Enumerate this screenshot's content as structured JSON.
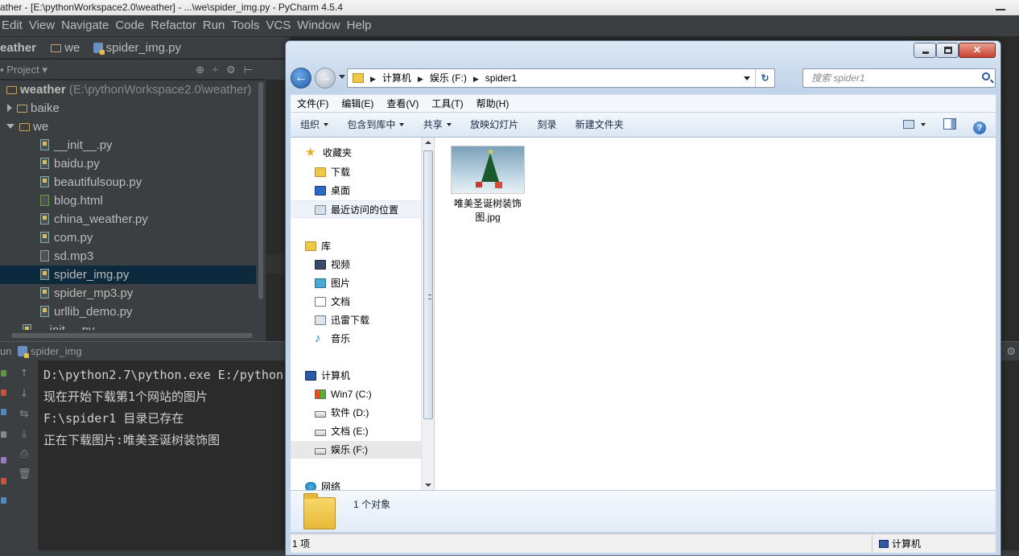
{
  "pycharm": {
    "title": "ather - [E:\\pythonWorkspace2.0\\weather] - ...\\we\\spider_img.py - PyCharm 4.5.4",
    "menu": [
      "Edit",
      "View",
      "Navigate",
      "Code",
      "Refactor",
      "Run",
      "Tools",
      "VCS",
      "Window",
      "Help"
    ],
    "breadcrumb": {
      "root": "eather",
      "folder": "we",
      "file": "spider_img.py"
    },
    "project_panel": {
      "title": "Project",
      "root_label": "weather",
      "root_path": "(E:\\pythonWorkspace2.0\\weather)",
      "items": [
        {
          "label": "baike",
          "kind": "folder"
        },
        {
          "label": "we",
          "kind": "folder-open"
        },
        {
          "label": "__init__.py",
          "kind": "py"
        },
        {
          "label": "baidu.py",
          "kind": "py"
        },
        {
          "label": "beautifulsoup.py",
          "kind": "py"
        },
        {
          "label": "blog.html",
          "kind": "html"
        },
        {
          "label": "china_weather.py",
          "kind": "py"
        },
        {
          "label": "com.py",
          "kind": "py"
        },
        {
          "label": "sd.mp3",
          "kind": "mp3"
        },
        {
          "label": "spider_img.py",
          "kind": "py",
          "selected": true
        },
        {
          "label": "spider_mp3.py",
          "kind": "py"
        },
        {
          "label": "urllib_demo.py",
          "kind": "py"
        },
        {
          "label": "__init__.py",
          "kind": "py"
        }
      ]
    },
    "run_panel": {
      "title": "un",
      "config": "spider_img",
      "console_lines": [
        "D:\\python2.7\\python.exe E:/python",
        "现在开始下载第1个网站的图片",
        "F:\\spider1 目录已存在",
        "正在下载图片:唯美圣诞树装饰图"
      ]
    }
  },
  "explorer": {
    "address": {
      "segments": [
        "计算机",
        "娱乐 (F:)",
        "spider1"
      ]
    },
    "search_placeholder": "搜索 spider1",
    "menu": [
      "文件(F)",
      "编辑(E)",
      "查看(V)",
      "工具(T)",
      "帮助(H)"
    ],
    "commands": [
      "组织",
      "包含到库中",
      "共享",
      "放映幻灯片",
      "刻录",
      "新建文件夹"
    ],
    "nav": {
      "favorites_header": "收藏夹",
      "favorites": [
        "下载",
        "桌面",
        "最近访问的位置"
      ],
      "libraries_header": "库",
      "libraries": [
        "视频",
        "图片",
        "文档",
        "迅雷下载",
        "音乐"
      ],
      "computer_header": "计算机",
      "drives": [
        "Win7 (C:)",
        "软件 (D:)",
        "文档 (E:)",
        "娱乐 (F:)"
      ],
      "network_header": "网络"
    },
    "file": {
      "name_line1": "唯美圣诞树装饰",
      "name_line2": "图.jpg"
    },
    "details_text": "1 个对象",
    "status_left": "1 项",
    "status_right": "计算机"
  }
}
